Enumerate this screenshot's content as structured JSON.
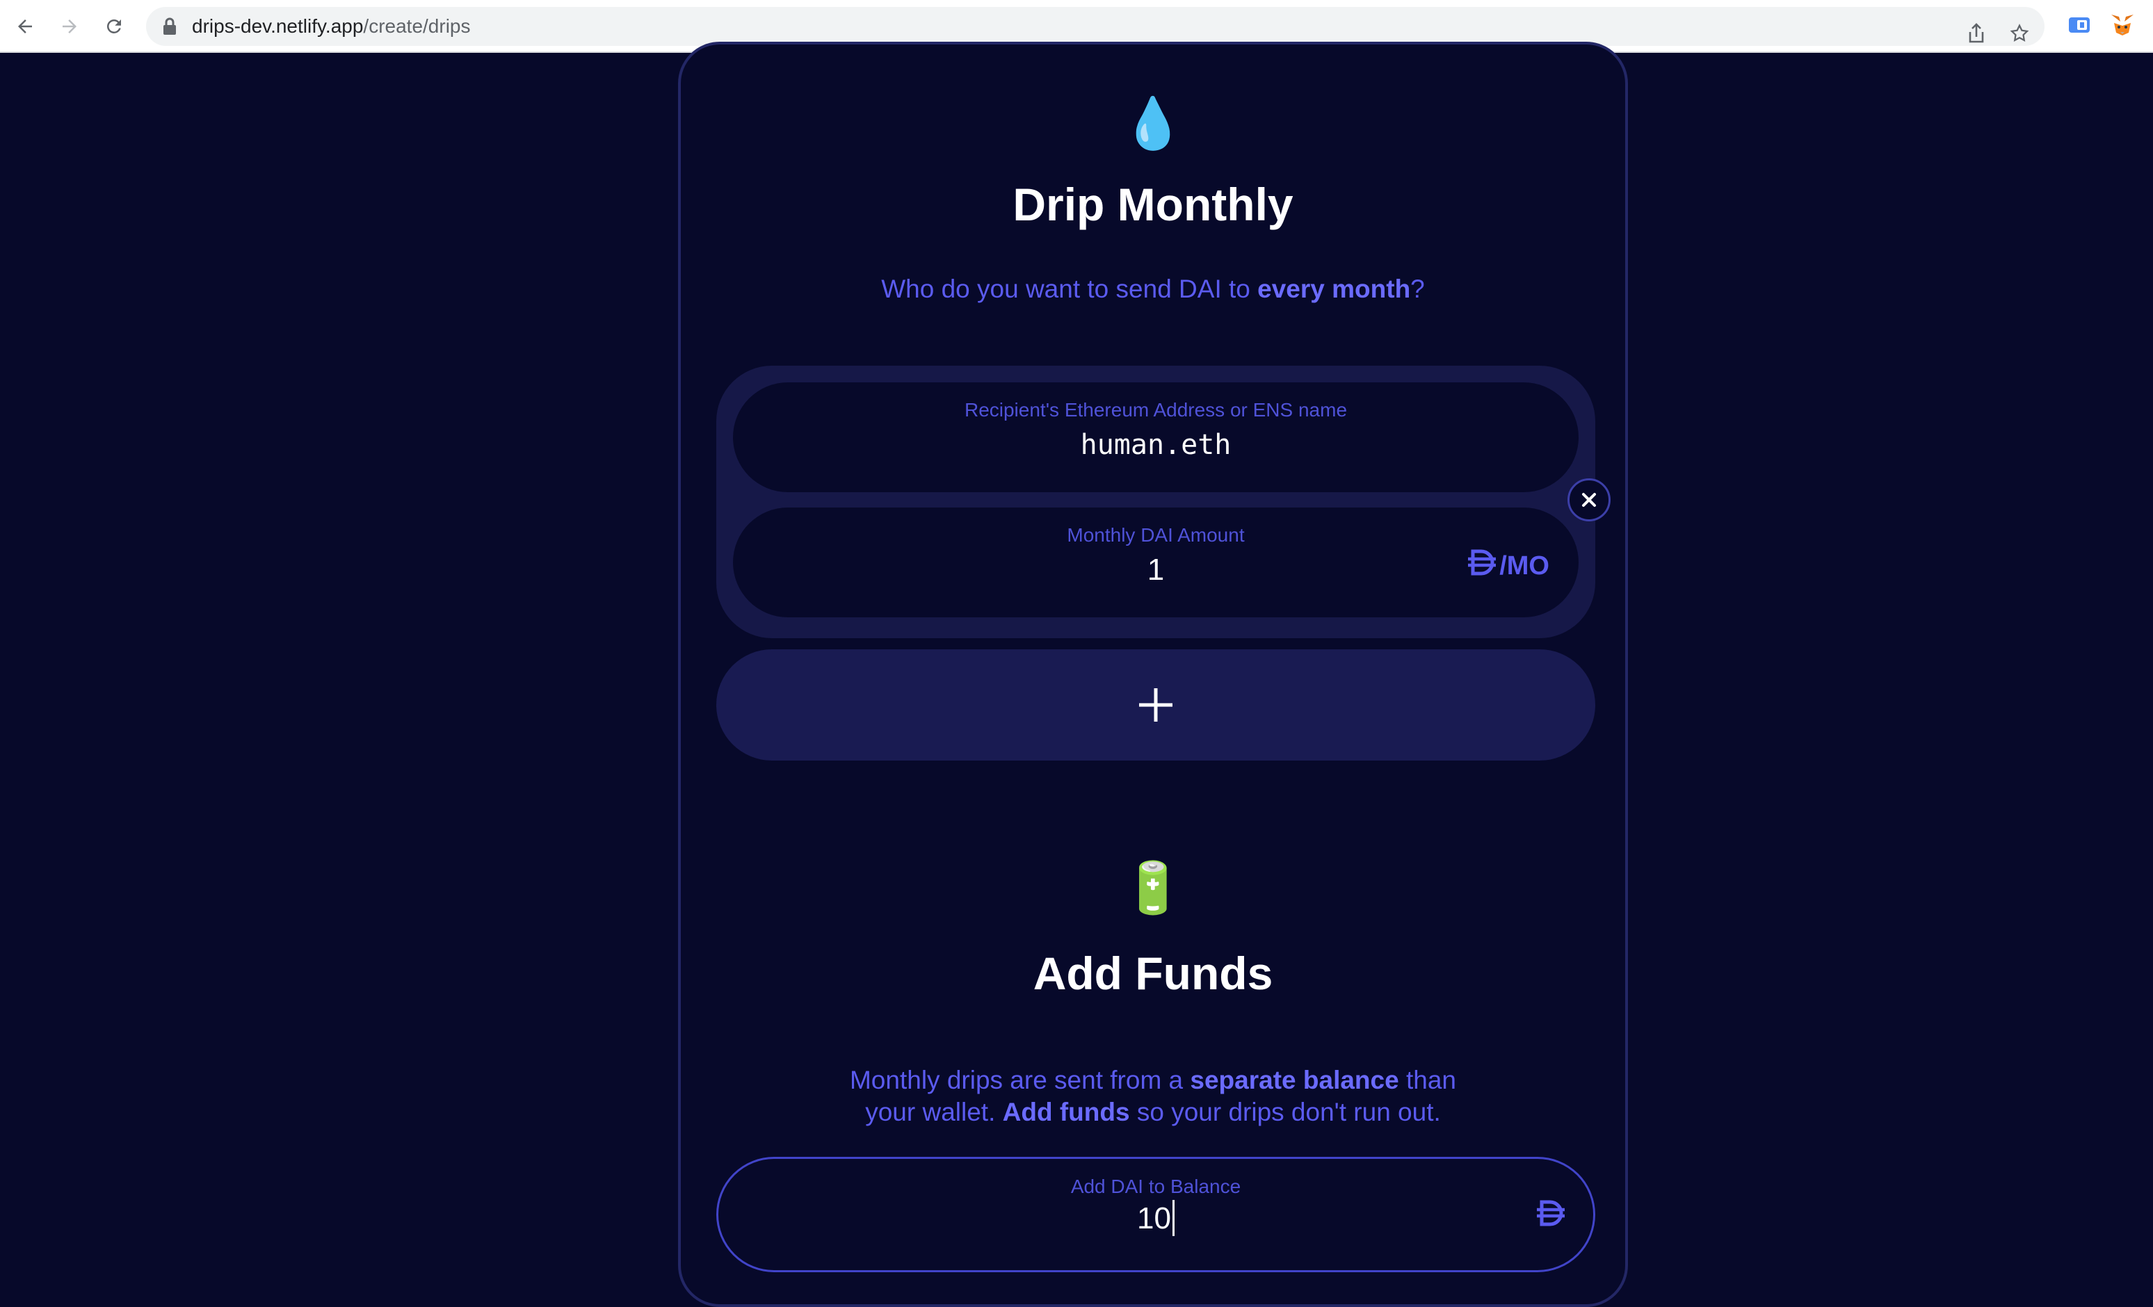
{
  "browser": {
    "url_host": "drips-dev.netlify.app",
    "url_path": "/create/drips",
    "icons": [
      "back-icon",
      "forward-icon",
      "reload-icon",
      "lock-icon",
      "share-icon",
      "star-icon",
      "extension-icon",
      "metamask-icon"
    ]
  },
  "drip_section": {
    "emoji": "💧",
    "title": "Drip Monthly",
    "subtitle_prefix": "Who do you want to send DAI to ",
    "subtitle_bold": "every month",
    "subtitle_suffix": "?",
    "recipient_label": "Recipient's Ethereum Address or ENS name",
    "recipient_value": "human.eth",
    "amount_label": "Monthly DAI Amount",
    "amount_value": "1",
    "amount_unit": "/MO",
    "add_label": "+"
  },
  "funds_section": {
    "emoji": "🔋",
    "title": "Add Funds",
    "line1_prefix": "Monthly drips are sent from a ",
    "line1_bold": "separate balance",
    "line1_suffix": " than",
    "line2_prefix": "your wallet. ",
    "line2_bold": "Add funds",
    "line2_suffix": " so your drips don't run out.",
    "balance_label": "Add DAI to Balance",
    "balance_value": "10"
  },
  "colors": {
    "background": "#07092a",
    "accent": "#5b5bf0",
    "panel": "#161848"
  }
}
